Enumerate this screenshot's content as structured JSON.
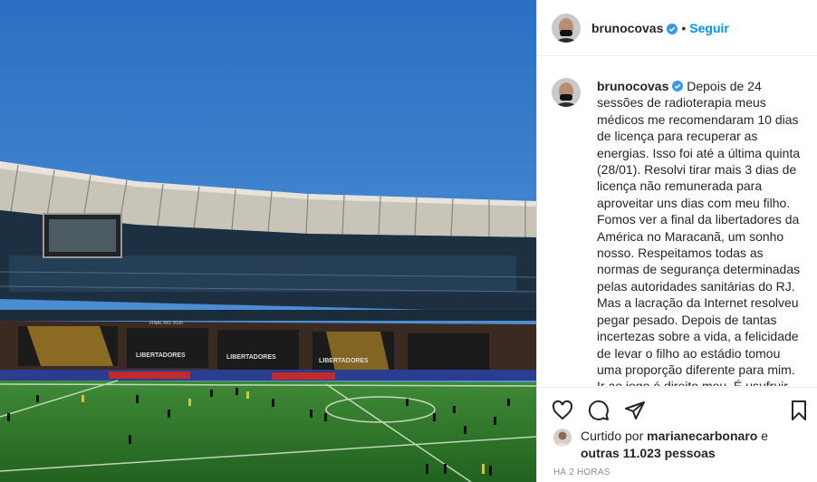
{
  "post": {
    "username": "brunocovas",
    "dot": "•",
    "follow_label": "Seguir"
  },
  "caption": {
    "username": "brunocovas",
    "text": "Depois de 24 sessões de radioterapia meus médicos me recomendaram 10 dias de licença para recuperar as energias. Isso foi até a última quinta (28/01). Resolvi tirar mais 3 dias de licença não remunerada para aproveitar uns dias com meu filho. Fomos ver a final da libertadores da América no Maracanã, um sonho nosso. Respeitamos todas as normas de segurança determinadas pelas autoridades sanitárias do RJ. Mas a lacração da Internet resolveu pegar pesado. Depois de tantas incertezas sobre a vida, a felicidade de levar o filho ao estádio tomou uma proporção diferente para mim. Ir ao jogo é direito meu. É usufruir de um pequeno prazer da vida. Mas a"
  },
  "likes": {
    "prefix": "Curtido por",
    "liker": "marianecarbonaro",
    "joiner": "e",
    "others": "outras 11.023 pessoas"
  },
  "timestamp": "HÁ 2 HORAS",
  "photo": {
    "banner_1": "LIBERTADORES",
    "banner_2": "LIBERTADORES",
    "banner_3": "LIBERTADORES",
    "banner_4": "FINAL RIO 2020"
  },
  "colors": {
    "sky": "#2f77c8",
    "pitch": "#2f7d2c",
    "link": "#0095f6",
    "verified": "#3897f0"
  },
  "icons": [
    "heart-icon",
    "comment-icon",
    "share-icon",
    "save-icon",
    "verified-icon"
  ]
}
